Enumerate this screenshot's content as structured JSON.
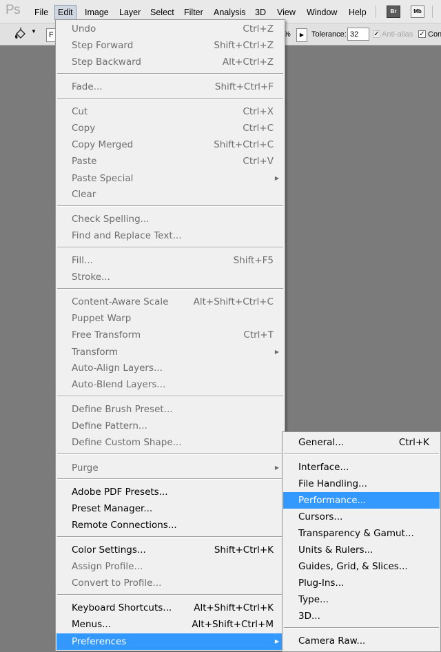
{
  "app": {
    "logo_text": "Ps",
    "menus": [
      "File",
      "Edit",
      "Image",
      "Layer",
      "Select",
      "Filter",
      "Analysis",
      "3D",
      "View",
      "Window",
      "Help"
    ],
    "bridge_btn": "Br",
    "minibridge_btn": "Mb"
  },
  "options_bar": {
    "fill_value": "F",
    "opacity_unit": "%",
    "tolerance_label": "Tolerance:",
    "tolerance_value": "32",
    "antialias_label": "Anti-alias",
    "contiguous_label": "Con"
  },
  "edit_menu": {
    "items": [
      {
        "label": "Undo",
        "shortcut": "Ctrl+Z",
        "disabled": true
      },
      {
        "label": "Step Forward",
        "shortcut": "Shift+Ctrl+Z",
        "disabled": true
      },
      {
        "label": "Step Backward",
        "shortcut": "Alt+Ctrl+Z",
        "disabled": true
      },
      {
        "label": "Fade...",
        "shortcut": "Shift+Ctrl+F",
        "disabled": true
      },
      {
        "label": "Cut",
        "shortcut": "Ctrl+X",
        "disabled": true
      },
      {
        "label": "Copy",
        "shortcut": "Ctrl+C",
        "disabled": true
      },
      {
        "label": "Copy Merged",
        "shortcut": "Shift+Ctrl+C",
        "disabled": true
      },
      {
        "label": "Paste",
        "shortcut": "Ctrl+V",
        "disabled": true
      },
      {
        "label": "Paste Special",
        "shortcut": "",
        "disabled": true,
        "submenu": true
      },
      {
        "label": "Clear",
        "shortcut": "",
        "disabled": true
      },
      {
        "label": "Check Spelling...",
        "shortcut": "",
        "disabled": true
      },
      {
        "label": "Find and Replace Text...",
        "shortcut": "",
        "disabled": true
      },
      {
        "label": "Fill...",
        "shortcut": "Shift+F5",
        "disabled": true
      },
      {
        "label": "Stroke...",
        "shortcut": "",
        "disabled": true
      },
      {
        "label": "Content-Aware Scale",
        "shortcut": "Alt+Shift+Ctrl+C",
        "disabled": true
      },
      {
        "label": "Puppet Warp",
        "shortcut": "",
        "disabled": true
      },
      {
        "label": "Free Transform",
        "shortcut": "Ctrl+T",
        "disabled": true
      },
      {
        "label": "Transform",
        "shortcut": "",
        "disabled": true,
        "submenu": true
      },
      {
        "label": "Auto-Align Layers...",
        "shortcut": "",
        "disabled": true
      },
      {
        "label": "Auto-Blend Layers...",
        "shortcut": "",
        "disabled": true
      },
      {
        "label": "Define Brush Preset...",
        "shortcut": "",
        "disabled": true
      },
      {
        "label": "Define Pattern...",
        "shortcut": "",
        "disabled": true
      },
      {
        "label": "Define Custom Shape...",
        "shortcut": "",
        "disabled": true
      },
      {
        "label": "Purge",
        "shortcut": "",
        "disabled": true,
        "submenu": true
      },
      {
        "label": "Adobe PDF Presets...",
        "shortcut": "",
        "disabled": false
      },
      {
        "label": "Preset Manager...",
        "shortcut": "",
        "disabled": false
      },
      {
        "label": "Remote Connections...",
        "shortcut": "",
        "disabled": false
      },
      {
        "label": "Color Settings...",
        "shortcut": "Shift+Ctrl+K",
        "disabled": false
      },
      {
        "label": "Assign Profile...",
        "shortcut": "",
        "disabled": true
      },
      {
        "label": "Convert to Profile...",
        "shortcut": "",
        "disabled": true
      },
      {
        "label": "Keyboard Shortcuts...",
        "shortcut": "Alt+Shift+Ctrl+K",
        "disabled": false
      },
      {
        "label": "Menus...",
        "shortcut": "Alt+Shift+Ctrl+M",
        "disabled": false
      },
      {
        "label": "Preferences",
        "shortcut": "",
        "disabled": false,
        "submenu": true,
        "highlighted": true
      }
    ]
  },
  "prefs_menu": {
    "items": [
      {
        "label": "General...",
        "shortcut": "Ctrl+K"
      },
      {
        "label": "Interface...",
        "shortcut": ""
      },
      {
        "label": "File Handling...",
        "shortcut": ""
      },
      {
        "label": "Performance...",
        "shortcut": "",
        "highlighted": true
      },
      {
        "label": "Cursors...",
        "shortcut": ""
      },
      {
        "label": "Transparency & Gamut...",
        "shortcut": ""
      },
      {
        "label": "Units & Rulers...",
        "shortcut": ""
      },
      {
        "label": "Guides, Grid, & Slices...",
        "shortcut": ""
      },
      {
        "label": "Plug-Ins...",
        "shortcut": ""
      },
      {
        "label": "Type...",
        "shortcut": ""
      },
      {
        "label": "3D...",
        "shortcut": ""
      },
      {
        "label": "Camera Raw...",
        "shortcut": ""
      }
    ]
  },
  "colors": {
    "highlight": "#3399ff",
    "menu_bg": "#f0f0f0",
    "canvas_bg": "#7b7b7b",
    "disabled_text": "#6d6d6d"
  }
}
